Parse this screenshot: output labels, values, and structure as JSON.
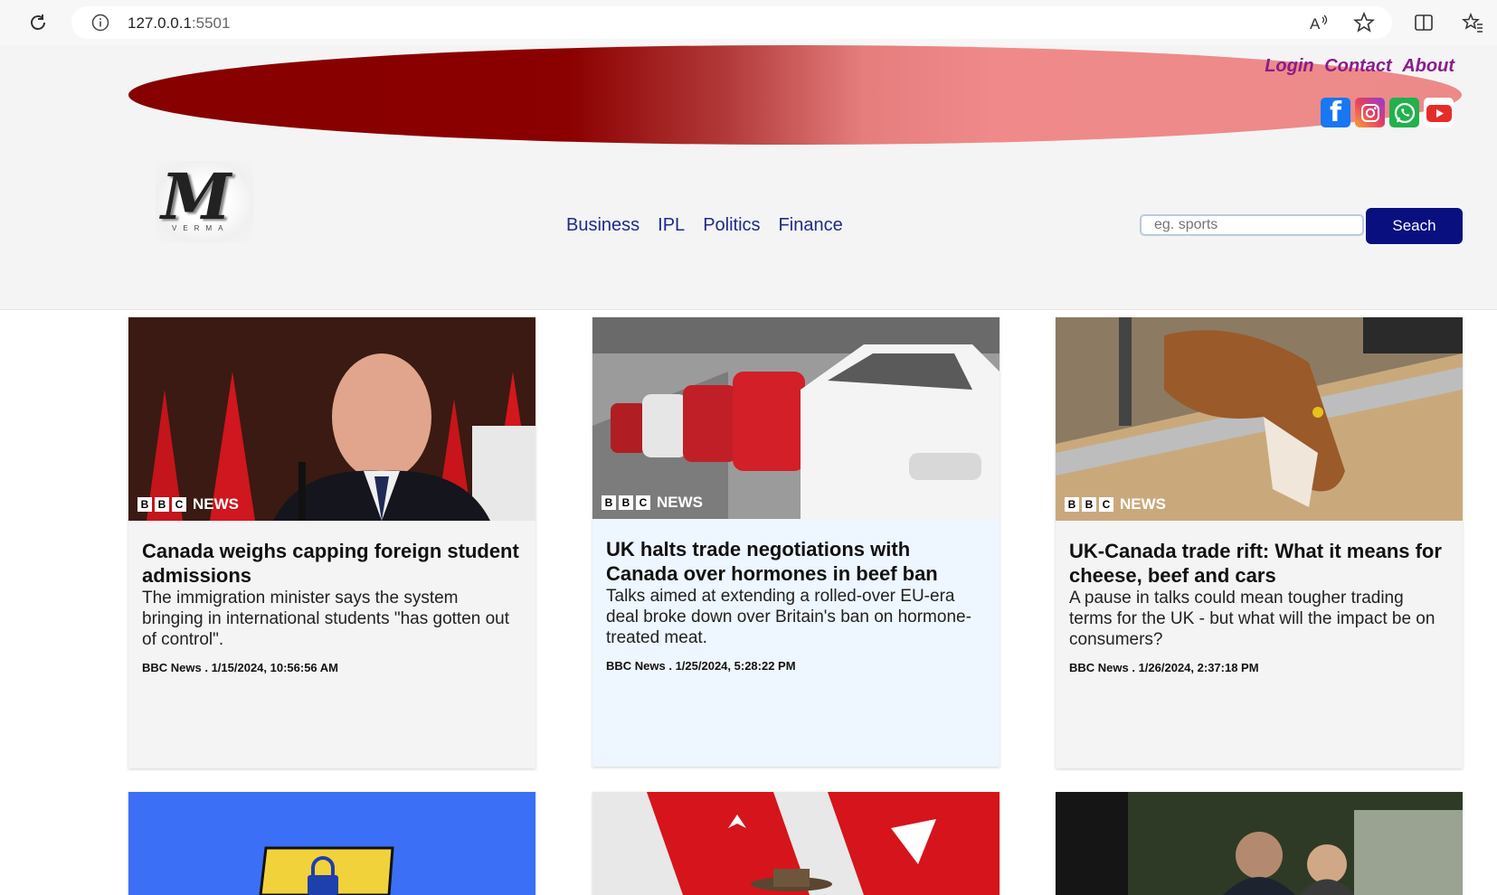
{
  "browser": {
    "url_host": "127.0.0.1",
    "url_port": ":5501"
  },
  "header": {
    "links": [
      "Login",
      "Contact",
      "About"
    ],
    "social": [
      "facebook-icon",
      "instagram-icon",
      "whatsapp-icon",
      "youtube-icon"
    ]
  },
  "logo": {
    "letter": "M",
    "name": "VERMA"
  },
  "nav": {
    "items": [
      "Business",
      "IPL",
      "Politics",
      "Finance"
    ]
  },
  "search": {
    "placeholder": "eg. sports",
    "button": "Seach"
  },
  "brand_tag": {
    "b1": "B",
    "b2": "B",
    "b3": "C",
    "news": "NEWS"
  },
  "cards": [
    {
      "title": "Canada weighs capping foreign student admissions",
      "description": "The immigration minister says the system bringing in international students \"has gotten out of control\".",
      "meta": "BBC News . 1/15/2024, 10:56:56 AM"
    },
    {
      "title": "UK halts trade negotiations with Canada over hormones in beef ban",
      "description": "Talks aimed at extending a rolled-over EU-era deal broke down over Britain's ban on hormone-treated meat.",
      "meta": "BBC News . 1/25/2024, 5:28:22 PM"
    },
    {
      "title": "UK-Canada trade rift: What it means for cheese, beef and cars",
      "description": "A pause in talks could mean tougher trading terms for the UK - but what will the impact be on consumers?",
      "meta": "BBC News . 1/26/2024, 2:37:18 PM"
    }
  ],
  "colors": {
    "banner_dark": "#8b0000",
    "banner_light": "#f08a8a",
    "link_purple": "#8a1c8a",
    "nav_blue": "#1f2a8a",
    "search_button": "#0a0f80"
  }
}
